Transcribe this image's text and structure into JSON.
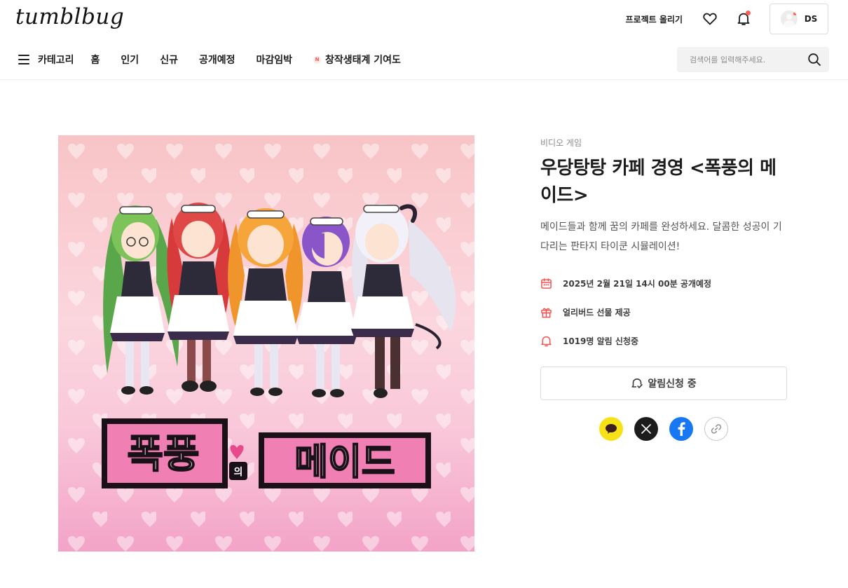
{
  "header": {
    "logo": "tumblbug",
    "upload_label": "프로젝트 올리기",
    "profile_name": "DS",
    "nav": {
      "category_label": "카테고리",
      "items": [
        "홈",
        "인기",
        "신규",
        "공개예정",
        "마감임박"
      ],
      "featured_badge": "N",
      "featured_label": "창작생태계 기여도"
    },
    "search": {
      "placeholder": "검색어를 입력해주세요."
    }
  },
  "project": {
    "category": "비디오 게임",
    "title": "우당탕탕 카페 경영 <폭풍의 메이드>",
    "subtitle": "메이드들과 함께 꿈의 카페를 완성하세요. 달콤한 성공이 기다리는 판타지 타이쿤 시뮬레이션!",
    "cover_logo_text": "폭풍의 메이드",
    "meta": {
      "launch": "2025년 2월 21일 14시 00분 공개예정",
      "earlybird": "얼리버드 선물 제공",
      "subscribers": "1019명 알림 신청중"
    },
    "notify_label": "알림신청 중"
  },
  "share": {
    "icons": [
      "kakao-icon",
      "x-icon",
      "facebook-icon",
      "link-icon"
    ]
  },
  "colors": {
    "accent": "#f86453",
    "kakao": "#f7e217",
    "facebook": "#1877f2",
    "x": "#1c1c1c",
    "cover_bg_top": "#f8c6cb",
    "cover_bg_bottom": "#f3a3c7"
  }
}
